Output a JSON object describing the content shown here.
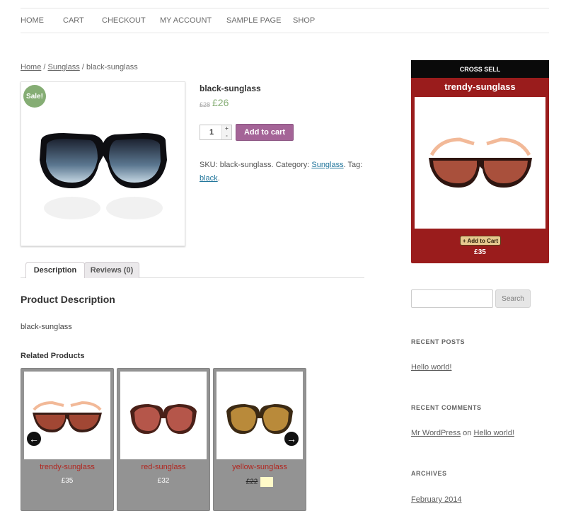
{
  "nav": {
    "items": [
      "HOME",
      "CART",
      "CHECKOUT",
      "MY ACCOUNT",
      "SAMPLE PAGE",
      "SHOP"
    ]
  },
  "breadcrumb": {
    "home": "Home",
    "sep1": " / ",
    "category": "Sunglass",
    "sep2": " / ",
    "current": "black-sunglass"
  },
  "product": {
    "sale_badge": "Sale!",
    "title": "black-sunglass",
    "old_price": "£28",
    "new_price": "£26",
    "quantity": "1",
    "qty_up": "+",
    "qty_down": "-",
    "add_to_cart": "Add to cart",
    "sku_label": "SKU: ",
    "sku": "black-sunglass",
    "category_label": ". Category: ",
    "category": "Sunglass",
    "tag_label": ". Tag: ",
    "tag": "black",
    "end": "."
  },
  "tabs": [
    {
      "label": "Description",
      "active": true
    },
    {
      "label": "Reviews (0)",
      "active": false
    }
  ],
  "description": {
    "heading": "Product Description",
    "text": "black-sunglass"
  },
  "related": {
    "heading": "Related Products",
    "items": [
      {
        "name": "trendy-sunglass",
        "price": "£35"
      },
      {
        "name": "red-sunglass",
        "price": "£32"
      },
      {
        "name": "yellow-sunglass",
        "price": "£22"
      }
    ],
    "prev_arrow": "←",
    "next_arrow": "→"
  },
  "cross_sell": {
    "heading": "CROSS SELL",
    "title": "trendy-sunglass",
    "button": "+ Add to Cart",
    "price": "£35"
  },
  "sidebar": {
    "search_placeholder": "",
    "search_button": "Search",
    "recent_posts_heading": "RECENT POSTS",
    "recent_post": "Hello world!",
    "recent_comments_heading": "RECENT COMMENTS",
    "comment_author": "Mr WordPress",
    "comment_on": " on ",
    "comment_post": "Hello world!",
    "archives_heading": "ARCHIVES",
    "archive_item": "February 2014"
  },
  "colors": {
    "accent_purple": "#a46497",
    "sale_green": "#85ad74",
    "cross_sell_red": "#9a1c1c",
    "related_name_red": "#b1251f"
  }
}
